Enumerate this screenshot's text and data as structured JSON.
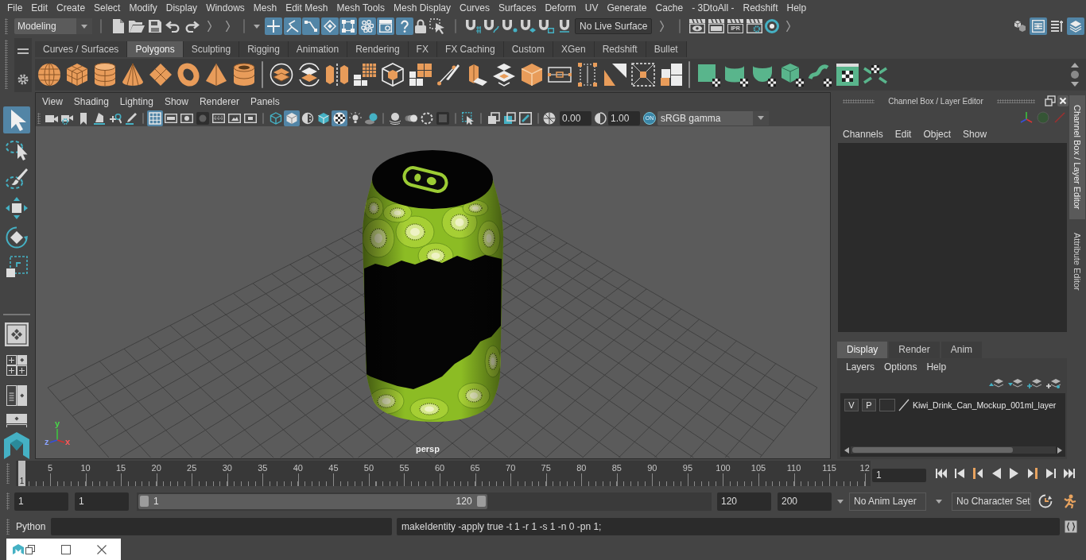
{
  "menu_bar": [
    "File",
    "Edit",
    "Create",
    "Select",
    "Modify",
    "Display",
    "Windows",
    "Mesh",
    "Edit Mesh",
    "Mesh Tools",
    "Mesh Display",
    "Curves",
    "Surfaces",
    "Deform",
    "UV",
    "Generate",
    "Cache",
    "- 3DtoAll -",
    "Redshift",
    "Help"
  ],
  "status_line": {
    "workspace": "Modeling",
    "selection_masks": [
      {
        "on": true
      },
      {
        "on": true
      },
      {
        "on": true
      },
      {
        "on": true
      },
      {
        "on": true
      },
      {
        "on": true
      },
      {
        "on": true
      },
      {
        "on": true
      }
    ],
    "live_surface": "No Live Surface",
    "ipr_label": "IPR",
    "panel_toggles": [
      {
        "on": false
      },
      {
        "on": true
      },
      {
        "on": false
      },
      {
        "on": true
      }
    ]
  },
  "shelf": {
    "tabs": [
      {
        "label": "Curves / Surfaces",
        "selected": false
      },
      {
        "label": "Polygons",
        "selected": true
      },
      {
        "label": "Sculpting",
        "selected": false
      },
      {
        "label": "Rigging",
        "selected": false
      },
      {
        "label": "Animation",
        "selected": false
      },
      {
        "label": "Rendering",
        "selected": false
      },
      {
        "label": "FX",
        "selected": false
      },
      {
        "label": "FX Caching",
        "selected": false
      },
      {
        "label": "Custom",
        "selected": false
      },
      {
        "label": "XGen",
        "selected": false
      },
      {
        "label": "Redshift",
        "selected": false
      },
      {
        "label": "Bullet",
        "selected": false
      }
    ]
  },
  "toolbox": {
    "tools": [
      {
        "selected": true
      },
      {
        "selected": false
      },
      {
        "selected": false
      },
      {
        "selected": false
      },
      {
        "selected": false
      },
      {
        "selected": false
      }
    ]
  },
  "viewport": {
    "menu": [
      "View",
      "Shading",
      "Lighting",
      "Show",
      "Renderer",
      "Panels"
    ],
    "toolbar_groups": [
      [
        {
          "on": false
        },
        {
          "on": false
        },
        {
          "on": false
        },
        {
          "on": false
        },
        {
          "on": false
        },
        {
          "on": false
        }
      ],
      [
        {
          "on": true
        },
        {
          "on": false
        },
        {
          "on": false
        },
        {
          "on": false
        },
        {
          "on": false
        },
        {
          "on": false
        },
        {
          "on": false
        }
      ],
      [
        {
          "on": false
        },
        {
          "on": true
        },
        {
          "on": false
        },
        {
          "on": false
        },
        {
          "on": true
        },
        {
          "on": false
        },
        {
          "on": false
        }
      ],
      [
        {
          "on": false
        },
        {
          "on": false
        },
        {
          "on": false
        },
        {
          "on": false
        }
      ],
      [
        {
          "on": false
        }
      ],
      [
        {
          "on": false
        },
        {
          "on": false
        },
        {
          "on": false
        }
      ]
    ],
    "exposure": "0.00",
    "gamma": "1.00",
    "color_management": {
      "label": "ON",
      "on": true
    },
    "view_transform": "sRGB gamma",
    "axis_labels": [
      "y",
      "z",
      "x"
    ],
    "camera": "persp"
  },
  "channel_box": {
    "title": "Channel Box / Layer Editor",
    "menu": [
      "Channels",
      "Edit",
      "Object",
      "Show"
    ]
  },
  "layer_editor": {
    "tabs": [
      {
        "label": "Display",
        "selected": true
      },
      {
        "label": "Render",
        "selected": false
      },
      {
        "label": "Anim",
        "selected": false
      }
    ],
    "menu": [
      "Layers",
      "Options",
      "Help"
    ],
    "layers": [
      {
        "visible": "V",
        "playback": "P",
        "name": "Kiwi_Drink_Can_Mockup_001ml_layer"
      }
    ]
  },
  "side_tabs": [
    {
      "label": "Channel Box / Layer Editor",
      "selected": true
    },
    {
      "label": "Attribute Editor",
      "selected": false
    }
  ],
  "time_slider": {
    "labels": [
      "5",
      "10",
      "15",
      "20",
      "25",
      "30",
      "35",
      "40",
      "45",
      "50",
      "55",
      "60",
      "65",
      "70",
      "75",
      "80",
      "85",
      "90",
      "95",
      "100",
      "105",
      "110",
      "115",
      "12"
    ],
    "current_frame": "1",
    "level": 0,
    "current_time": "1"
  },
  "range_slider": {
    "start": "1",
    "playback_start": "1",
    "range_start": "1",
    "range_end": "120",
    "level": 0.61,
    "playback_end": "120",
    "end": "200"
  },
  "anim_layer": "No Anim Layer",
  "character_set": "No Character Set",
  "command_line": {
    "language": "Python",
    "result": "makeIdentity -apply true -t 1 -r 1 -s 1 -n 0 -pn 1;"
  }
}
